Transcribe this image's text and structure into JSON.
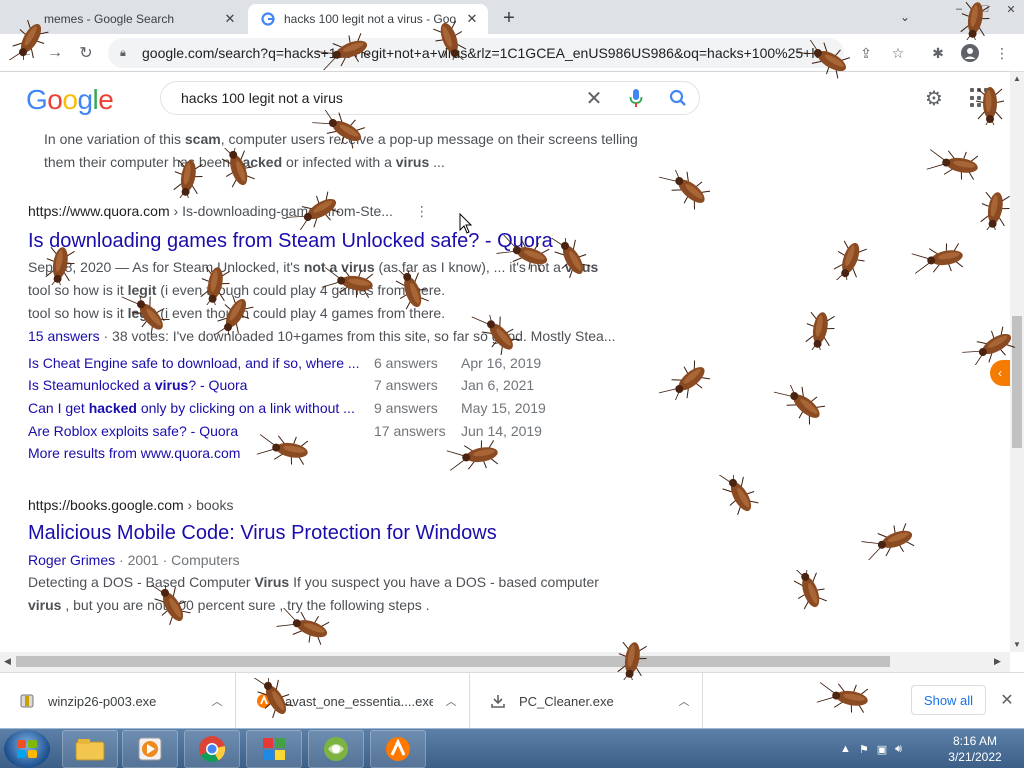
{
  "browser": {
    "tabs": [
      {
        "title": "memes - Google Search",
        "active": false
      },
      {
        "title": "hacks 100 legit not a virus - Goo",
        "active": true
      }
    ],
    "url": "google.com/search?q=hacks+100+legit+not+a+virus&rlz=1C1GCEA_enUS986US986&oq=hacks+100%25+le"
  },
  "google": {
    "logo_letters": [
      {
        "ch": "G",
        "color": "#4285F4"
      },
      {
        "ch": "o",
        "color": "#EA4335"
      },
      {
        "ch": "o",
        "color": "#FBBC05"
      },
      {
        "ch": "g",
        "color": "#4285F4"
      },
      {
        "ch": "l",
        "color": "#34A853"
      },
      {
        "ch": "e",
        "color": "#EA4335"
      }
    ],
    "query": "hacks 100 legit not a virus"
  },
  "results": {
    "top_snippet": {
      "l1a": "In one variation of this ",
      "l1b": "scam",
      "l1c": ", computer users receive a pop-up message on their screens telling",
      "l2a": "them their computer has been ",
      "l2b": "hacked",
      "l2c": " or infected with a ",
      "l2d": "virus",
      "l2e": " ..."
    },
    "quora": {
      "cite_domain": "https://www.quora.com",
      "cite_path": " › Is-downloading-games-from-Ste...",
      "title": "Is downloading games from Steam Unlocked safe? - Quora",
      "line1a": "Sep 18, 2020 — As for Steam Unlocked, it's ",
      "line1b": "not a virus",
      "line1c": " (as far as I know), ... it's not a ",
      "line1d": "virus",
      "line2a": "tool so how is it ",
      "line2b": "legit",
      "line2c": " (i even though could play 4 games from there.",
      "line3a": "tool so how is it ",
      "line3b": "legit",
      "line3c": " (i even though could play 4 games from there.",
      "line4_link": "15 answers",
      "line4_rest": " · 38 votes: I've downloaded 10+games from this site, so far so good. Mostly Stea...",
      "related": [
        {
          "q_pre": "Is Cheat Engine safe to download, and if so, where ...",
          "q_bold": "",
          "q_post": "",
          "answers": "6 answers",
          "date": "Apr 16, 2019"
        },
        {
          "q_pre": "Is Steamunlocked a ",
          "q_bold": "virus",
          "q_post": "? - Quora",
          "answers": "7 answers",
          "date": "Jan 6, 2021"
        },
        {
          "q_pre": "Can I get ",
          "q_bold": "hacked",
          "q_post": " only by clicking on a link without ...",
          "answers": "9 answers",
          "date": "May 15, 2019"
        },
        {
          "q_pre": "Are Roblox exploits safe? - Quora",
          "q_bold": "",
          "q_post": "",
          "answers": "17 answers",
          "date": "Jun 14, 2019"
        }
      ],
      "more": "More results from www.quora.com"
    },
    "books": {
      "cite_domain": "https://books.google.com",
      "cite_path": " › books",
      "title": "Malicious Mobile Code: Virus Protection for Windows",
      "author": "Roger Grimes",
      "meta_rest": " · 2001 · Computers",
      "line1a": "Detecting a DOS - Based Computer ",
      "line1b": "Virus",
      "line1c": " If you suspect you have a DOS - based computer",
      "line2a": "virus",
      "line2b": " , but you are not 100 percent sure , try the following steps ."
    }
  },
  "downloads": {
    "items": [
      {
        "name": "winzip26-p003.exe",
        "icon": "winzip-icon"
      },
      {
        "name": "avast_one_essentia....exe",
        "icon": "avast-icon"
      },
      {
        "name": "PC_Cleaner.exe",
        "icon": "download-icon"
      }
    ],
    "show_all": "Show all"
  },
  "taskbar": {
    "time": "8:16 AM",
    "date": "3/21/2022",
    "apps": [
      "file-explorer-icon",
      "media-player-icon",
      "chrome-icon",
      "winzip-icon",
      "pc-cleaner-icon",
      "avast-icon"
    ]
  },
  "colors": {
    "link": "#1a0dab",
    "bug": "#8a4a22"
  }
}
